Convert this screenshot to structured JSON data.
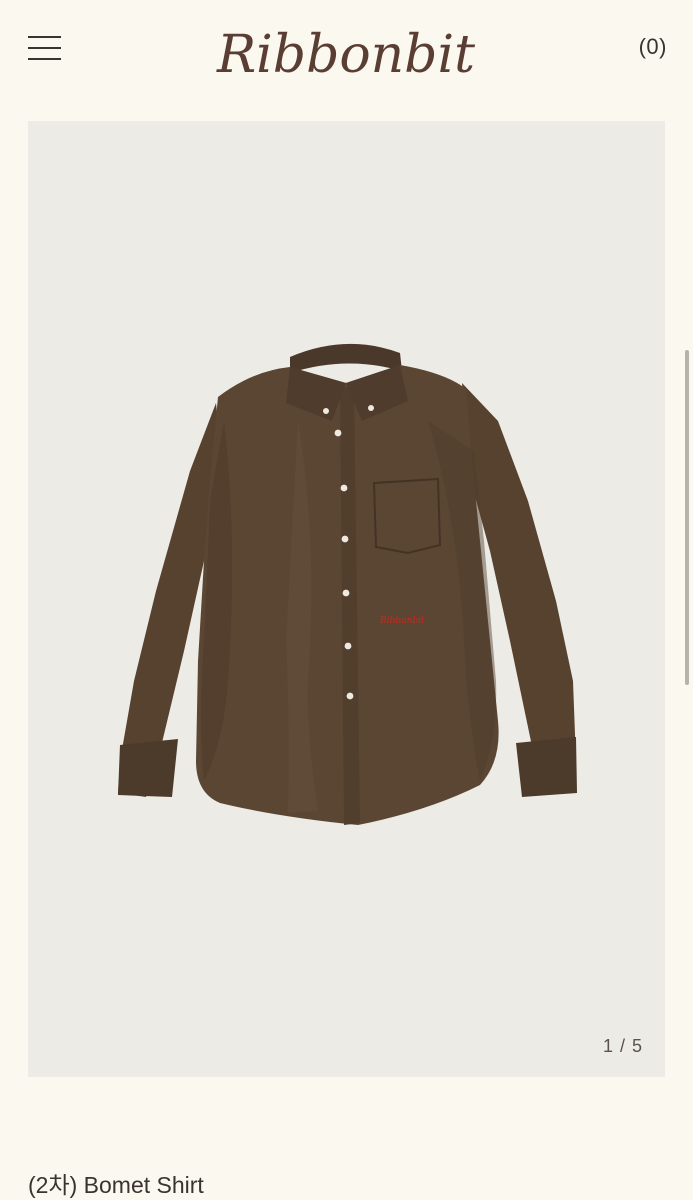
{
  "header": {
    "menu_icon": "hamburger-menu-icon",
    "logo_text": "Ribbonbit",
    "cart_label": "(0)"
  },
  "gallery": {
    "image_subject": "brown long-sleeve button-down shirt",
    "counter": "1 / 5",
    "current_index": 1,
    "total_images": 5
  },
  "product": {
    "title": "(2차) Bomet Shirt"
  },
  "colors": {
    "background": "#fbf8f0",
    "image_background": "#ecebe6",
    "text": "#3b3330",
    "shirt": "#5b4634",
    "logo": "#5a3e33"
  }
}
